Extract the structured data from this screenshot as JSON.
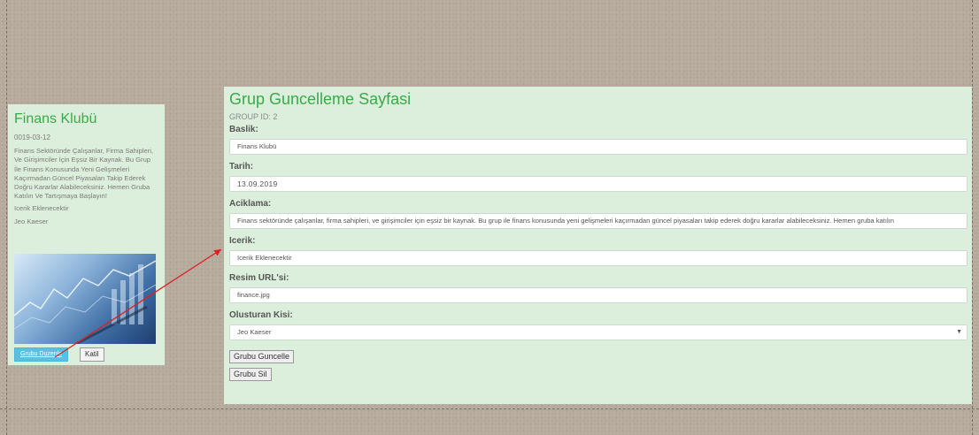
{
  "card": {
    "title": "Finans Klubü",
    "date": "0019-03-12",
    "description": "Finans Sektöründe Çalışanlar, Firma Sahipleri, Ve Girişimciler İçin Eşsiz Bir Kaynak. Bu Grup İle Finans Konusunda Yeni Gelişmeleri Kaçırmadan Güncel Piyasaları Takip Ederek Doğru Kararlar Alabileceksiniz. Hemen Gruba Katılın Ve Tartışmaya Başlayın!",
    "content": "Icerik Eklenecektir",
    "author": "Jeo Kaeser",
    "edit_label": "Grubu Duzenle",
    "join_label": "Katil"
  },
  "panel": {
    "title": "Grup Guncelleme Sayfasi",
    "group_id": "GROUP ID: 2",
    "fields": {
      "baslik_label": "Baslik:",
      "baslik_value": "Finans Klubü",
      "tarih_label": "Tarih:",
      "tarih_value": "13.09.2019",
      "aciklama_label": "Aciklama:",
      "aciklama_value": "Finans sektöründe çalışanlar, firma sahipleri, ve girişimciler için eşsiz bir kaynak. Bu grup ile finans konusunda yeni gelişmeleri kaçırmadan güncel piyasaları takip ederek doğru kararlar alabileceksiniz. Hemen gruba katılın",
      "icerik_label": "Icerik:",
      "icerik_value": "Icerik Eklenecektir",
      "resim_label": "Resim URL'si:",
      "resim_value": "finance.jpg",
      "olusturan_label": "Olusturan Kisi:",
      "olusturan_value": "Jeo Kaeser"
    },
    "update_label": "Grubu Guncelle",
    "delete_label": "Grubu Sil"
  },
  "colors": {
    "title_green": "#3aaa49",
    "panel_bg": "#dcefdc",
    "arrow": "#e02020",
    "edit_button": "#5bc0de"
  }
}
